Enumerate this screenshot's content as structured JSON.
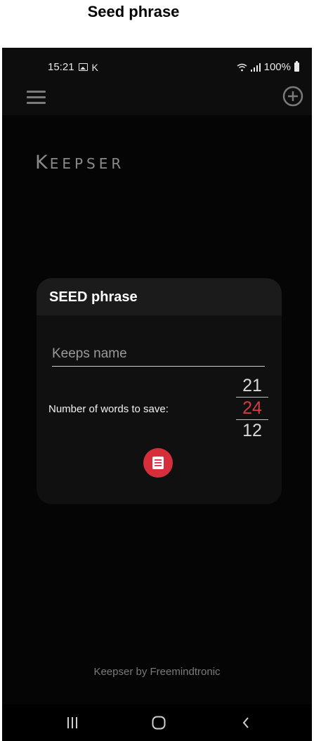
{
  "page": {
    "heading": "Seed phrase"
  },
  "status_bar": {
    "time": "15:21",
    "notif_letter": "K",
    "battery": "100%",
    "icons": [
      "image-icon",
      "wifi-icon",
      "signal-icon",
      "battery-icon"
    ]
  },
  "app_bar": {
    "menu_icon": "hamburger-menu-icon",
    "add_icon": "add-circle-icon"
  },
  "logo": {
    "first": "K",
    "rest": "EEPSER"
  },
  "card": {
    "title": "SEED phrase",
    "name_placeholder": "Keeps name",
    "name_value": "",
    "words_label": "Number of words to save:",
    "word_count_options": [
      "21",
      "24",
      "12"
    ],
    "word_count_selected": "24",
    "save_icon": "save-document-icon"
  },
  "footer": {
    "credit": "Keepser by Freemindtronic"
  },
  "colors": {
    "accent": "#d62f3b",
    "selected_value": "#d63b45",
    "background": "#050505",
    "card": "#101010",
    "card_header": "#1b1b1b"
  }
}
